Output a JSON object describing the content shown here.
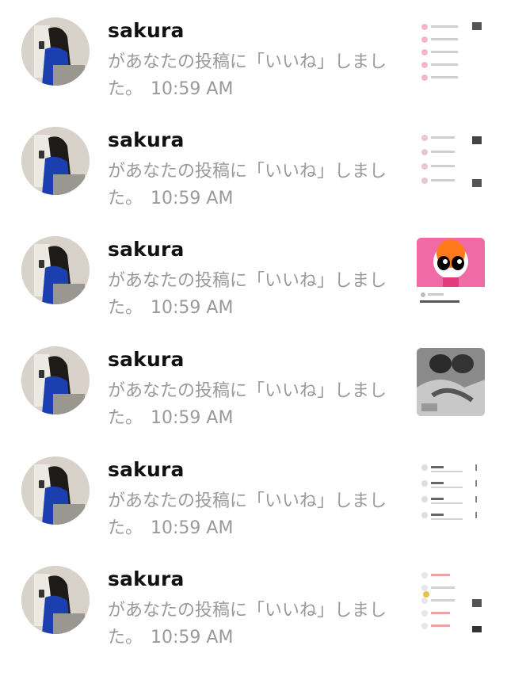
{
  "notifications": [
    {
      "username": "sakura",
      "action": "があなたの投稿に「いいね」しました。",
      "time": "10:59 AM",
      "thumb_icon": "post-list-thumbnail-icon"
    },
    {
      "username": "sakura",
      "action": "があなたの投稿に「いいね」しました。",
      "time": "10:59 AM",
      "thumb_icon": "post-list-thumbnail-icon"
    },
    {
      "username": "sakura",
      "action": "があなたの投稿に「いいね」しました。",
      "time": "10:59 AM",
      "thumb_icon": "cartoon-character-thumbnail-icon"
    },
    {
      "username": "sakura",
      "action": "があなたの投稿に「いいね」しました。",
      "time": "10:59 AM",
      "thumb_icon": "grayscale-photo-thumbnail-icon"
    },
    {
      "username": "sakura",
      "action": "があなたの投稿に「いいね」しました。",
      "time": "10:59 AM",
      "thumb_icon": "post-list-thumbnail-icon"
    },
    {
      "username": "sakura",
      "action": "があなたの投稿に「いいね」しました。",
      "time": "10:59 AM",
      "thumb_icon": "post-list-thumbnail-icon"
    }
  ],
  "colors": {
    "username": "#111111",
    "secondary_text": "#9a9a9a",
    "background": "#ffffff"
  }
}
